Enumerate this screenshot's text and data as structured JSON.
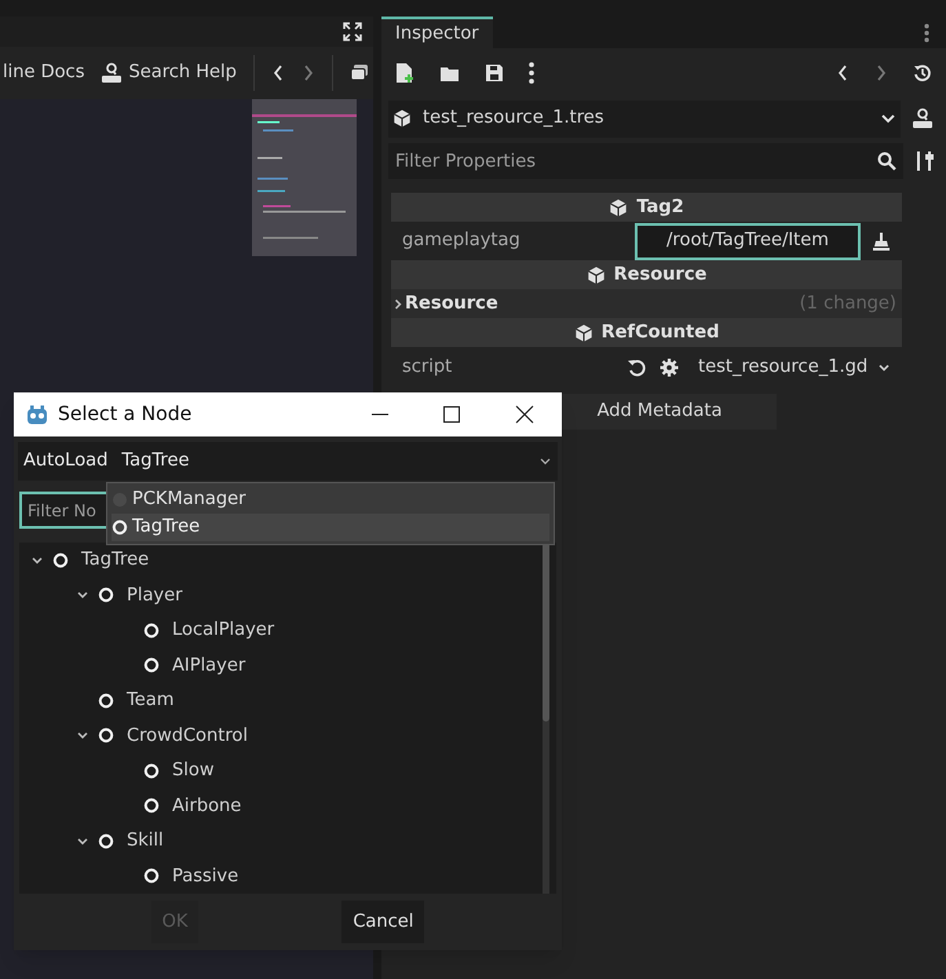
{
  "editor": {
    "toolbar": [
      {
        "kind": "link",
        "label": "line Docs"
      },
      {
        "kind": "search",
        "label": "Search Help"
      }
    ]
  },
  "inspector": {
    "tab": {
      "label": "Inspector",
      "selected": true
    },
    "resource": "test_resource_1.tres",
    "filter": {
      "placeholder": "Filter Properties"
    },
    "rows": [
      {
        "kind": "header",
        "title": "Tag2"
      },
      {
        "kind": "property",
        "label": "gameplaytag",
        "value": "/root/TagTree/Item",
        "focused": true
      },
      {
        "kind": "header",
        "title": "Resource"
      },
      {
        "kind": "group",
        "title": "Resource",
        "note": "(1 change)",
        "expanded": false
      },
      {
        "kind": "header",
        "title": "RefCounted"
      },
      {
        "kind": "script",
        "label": "script",
        "value": "test_resource_1.gd"
      }
    ],
    "add_metadata": "Add Metadata"
  },
  "dialog": {
    "title": "Select a Node",
    "autoload_label": "AutoLoad",
    "autoload_value": "TagTree",
    "autoload_options": [
      {
        "label": "PCKManager",
        "selected": false
      },
      {
        "label": "TagTree",
        "selected": true
      }
    ],
    "filter": {
      "placeholder": "Filter No"
    },
    "tree": [
      {
        "label": "TagTree",
        "expanded": true,
        "children": [
          {
            "label": "Player",
            "expanded": true,
            "children": [
              {
                "label": "LocalPlayer"
              },
              {
                "label": "AIPlayer"
              }
            ]
          },
          {
            "label": "Team"
          },
          {
            "label": "CrowdControl",
            "expanded": true,
            "children": [
              {
                "label": "Slow"
              },
              {
                "label": "Airbone"
              }
            ]
          },
          {
            "label": "Skill",
            "expanded": true,
            "children": [
              {
                "label": "Passive"
              }
            ]
          }
        ]
      }
    ],
    "buttons": [
      {
        "label": "OK",
        "disabled": true
      },
      {
        "label": "Cancel",
        "disabled": false
      }
    ]
  }
}
